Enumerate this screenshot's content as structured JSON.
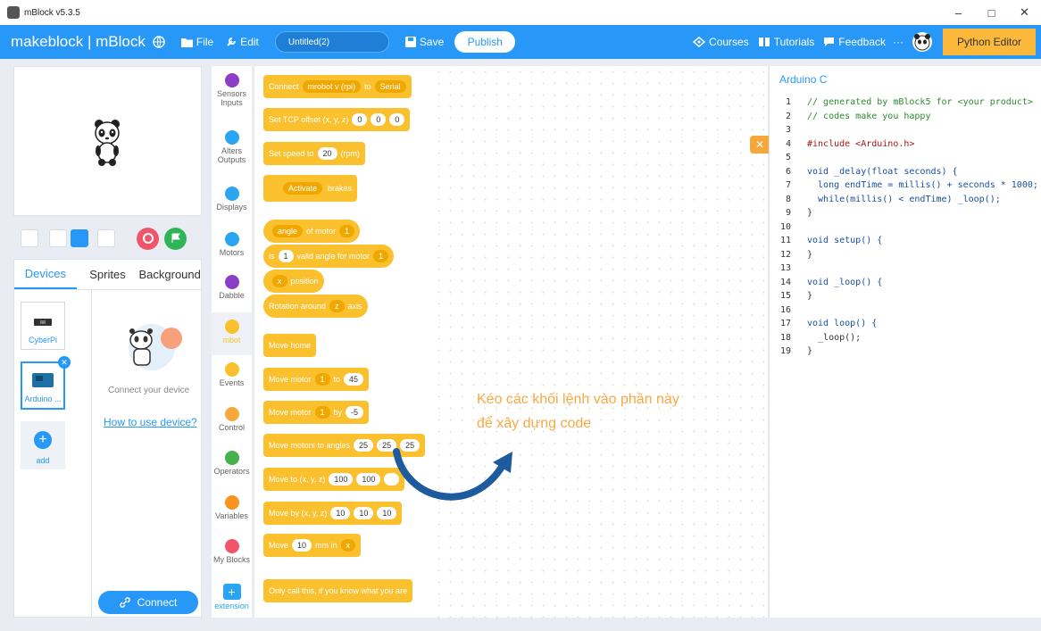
{
  "window": {
    "title": "mBlock v5.3.5",
    "controls": [
      "–",
      "□",
      "✕"
    ]
  },
  "menubar": {
    "brand": "makeblock | mBlock",
    "file": "File",
    "edit": "Edit",
    "project_name": "Untitled(2)",
    "save": "Save",
    "publish": "Publish",
    "courses": "Courses",
    "tutorials": "Tutorials",
    "feedback": "Feedback",
    "more": "···",
    "python_editor": "Python Editor"
  },
  "panel_tabs": [
    "Devices",
    "Sprites",
    "Background"
  ],
  "devices": [
    {
      "label": "CyberPi"
    },
    {
      "label": "Arduino ..."
    },
    {
      "label": "add"
    }
  ],
  "device_panel": {
    "connect_text": "Connect your device",
    "how_to": "How to use device?",
    "connect_button": "Connect"
  },
  "categories": [
    {
      "label": "Sensors\nInputs",
      "color": "#8a3fc6"
    },
    {
      "label": "Alters\nOutputs",
      "color": "#2aa5f1"
    },
    {
      "label": "Displays",
      "color": "#2aa5f1"
    },
    {
      "label": "Motors",
      "color": "#2aa5f1"
    },
    {
      "label": "Dabble",
      "color": "#8a3fc6"
    },
    {
      "label": "mbot",
      "color": "#fbc02d"
    },
    {
      "label": "Events",
      "color": "#fbc02d"
    },
    {
      "label": "Control",
      "color": "#f7a93b"
    },
    {
      "label": "Operators",
      "color": "#45b04c"
    },
    {
      "label": "Variables",
      "color": "#f7931e"
    },
    {
      "label": "My Blocks",
      "color": "#f0566a"
    },
    {
      "label": "extension",
      "color": "#2aa5f1"
    }
  ],
  "blocks": [
    {
      "text": "Connect",
      "args": [
        "mrobot v (rpi)",
        "to",
        "Serial"
      ]
    },
    {
      "text": "Set TCP offset (x, y, z)",
      "args": [
        "0",
        "0",
        "0"
      ]
    },
    {
      "text": "Set speed to",
      "args": [
        "20",
        "(rpm)"
      ]
    },
    {
      "text": "Activate",
      "args": [
        "brakes"
      ]
    },
    {
      "text": "angle",
      "args": [
        "of motor",
        "1"
      ]
    },
    {
      "text": "is",
      "args": [
        "1",
        "valid angle for motor",
        "1"
      ]
    },
    {
      "text": "x",
      "args": [
        "position"
      ]
    },
    {
      "text": "Rotation around",
      "args": [
        "z",
        "axis"
      ]
    },
    {
      "text": "Move home",
      "args": []
    },
    {
      "text": "Move motor",
      "args": [
        "1",
        "to",
        "45"
      ]
    },
    {
      "text": "Move motor",
      "args": [
        "1",
        "by",
        "-5"
      ]
    },
    {
      "text": "Move motors to angles",
      "args": [
        "25",
        "25",
        "25"
      ]
    },
    {
      "text": "Move to (x, y, z)",
      "args": [
        "100",
        "100",
        ""
      ]
    },
    {
      "text": "Move by (x, y, z)",
      "args": [
        "10",
        "10",
        "10"
      ]
    },
    {
      "text": "Move",
      "args": [
        "10",
        "mm in",
        "x"
      ]
    },
    {
      "text": "Only call this, if you know what you are",
      "args": []
    }
  ],
  "canvas": {
    "hint": "Kéo các khối lệnh vào phần này để xây dựng code"
  },
  "code": {
    "title": "Arduino C",
    "close_icon": "✕",
    "lines": [
      "// generated by mBlock5 for <your product>",
      "// codes make you happy",
      "",
      "#include <Arduino.h>",
      "",
      "void _delay(float seconds) {",
      "  long endTime = millis() + seconds * 1000;",
      "  while(millis() < endTime) _loop();",
      "}",
      "",
      "void setup() {",
      "}",
      "",
      "void _loop() {",
      "}",
      "",
      "void loop() {",
      "  _loop();",
      "}"
    ]
  },
  "colors": {
    "accent": "#2798f7",
    "python_btn": "#fbb83a",
    "block": "#fbc02d",
    "hint": "#f7a944"
  }
}
